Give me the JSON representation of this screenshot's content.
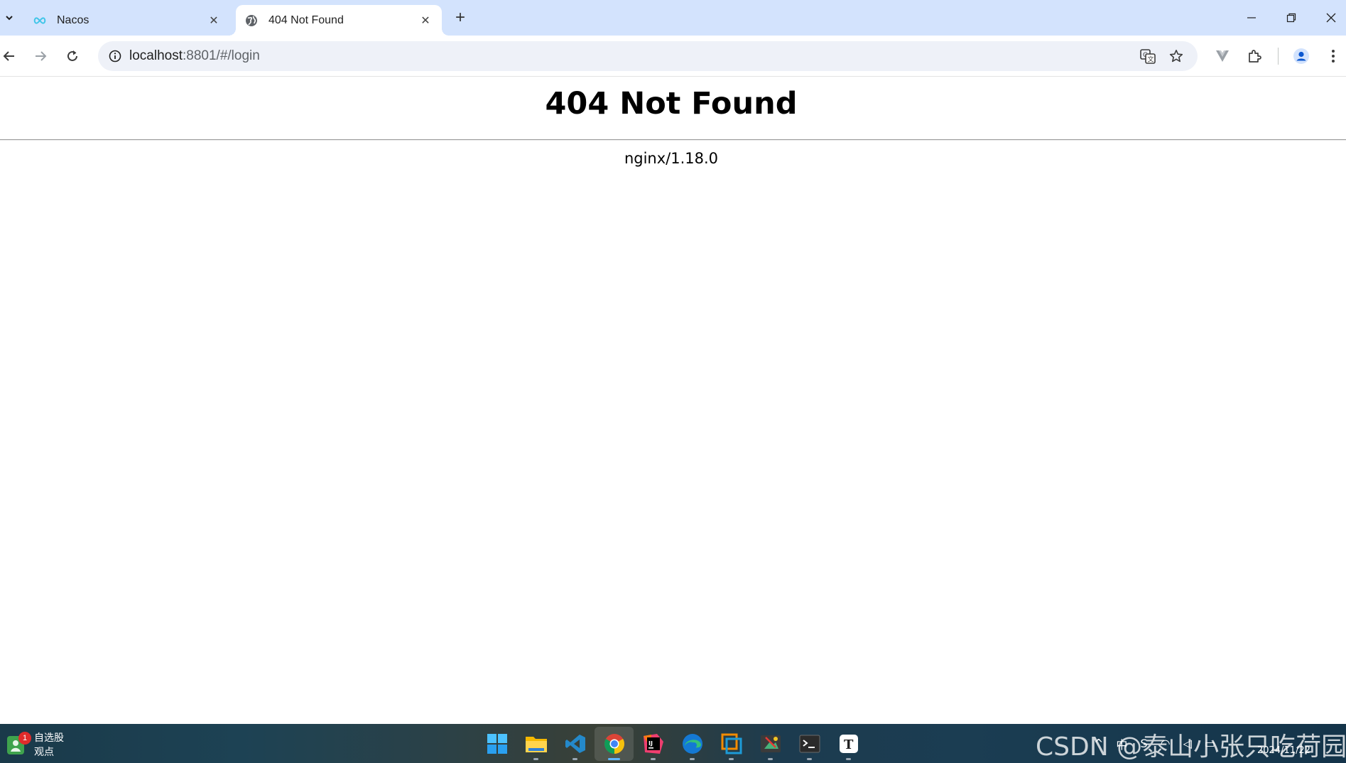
{
  "browser": {
    "tabs": [
      {
        "title": "Nacos",
        "icon": "nacos-infinity-icon",
        "active": false
      },
      {
        "title": "404 Not Found",
        "icon": "globe-icon",
        "active": true
      }
    ],
    "new_tab_label": "+",
    "close_glyph": "✕",
    "address": {
      "host": "localhost",
      "path": ":8801/#/login"
    }
  },
  "page": {
    "heading": "404 Not Found",
    "server": "nginx/1.18.0"
  },
  "taskbar": {
    "stock_widget": {
      "badge": "1",
      "line1": "自选股",
      "line2": "观点"
    },
    "apps": [
      "start-icon",
      "file-explorer-icon",
      "vscode-icon",
      "chrome-icon",
      "intellij-icon",
      "edge-icon",
      "vmware-icon",
      "snipping-tool-icon",
      "terminal-icon",
      "typora-icon"
    ],
    "active_app": "chrome-icon",
    "tray": {
      "ime": "中",
      "date": "2024/11/22"
    },
    "watermark": "CSDN @泰山小张只吃荷园"
  },
  "colors": {
    "tabstrip": "#d3e3fd",
    "omnibox": "#eef1f8",
    "accent": "#0b57d0"
  }
}
